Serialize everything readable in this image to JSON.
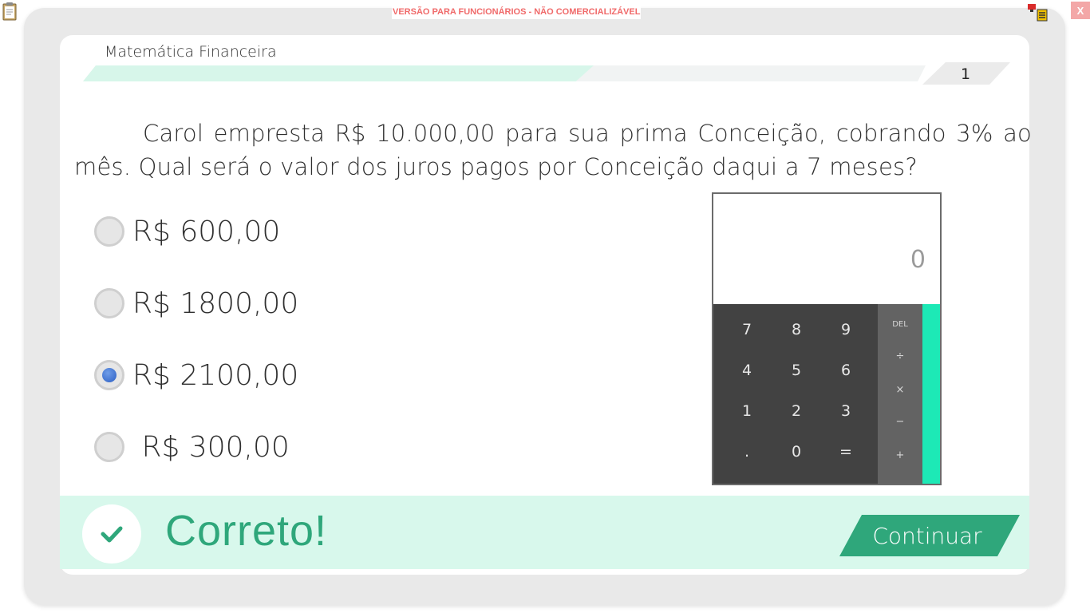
{
  "watermark": "VERSÃO PARA FUNCIONÁRIOS - NÃO COMERCIALIZÁVEL",
  "close_label": "X",
  "subject": "Matemática Financeira",
  "progress": {
    "value": 0.6,
    "question_number": "1"
  },
  "question": "Carol empresta R$ 10.000,00 para sua prima Conceição, cobrando 3% ao mês. Qual será o valor dos juros pagos por Conceição daqui a 7 meses?",
  "options": [
    {
      "label": "R$ 600,00",
      "selected": false
    },
    {
      "label": "R$ 1800,00",
      "selected": false
    },
    {
      "label": "R$ 2100,00",
      "selected": true
    },
    {
      "label": " R$ 300,00",
      "selected": false
    }
  ],
  "calculator": {
    "display": "0",
    "keys": [
      "7",
      "8",
      "9",
      "4",
      "5",
      "6",
      "1",
      "2",
      "3",
      ".",
      "0",
      "="
    ],
    "ops": [
      "DEL",
      "÷",
      "×",
      "−",
      "+"
    ]
  },
  "feedback": {
    "text": "Correto!",
    "continue_label": "Continuar"
  },
  "colors": {
    "accent": "#2fa77b",
    "feedback_bg": "#d8f8ec",
    "calc_accent": "#1de9b6"
  }
}
